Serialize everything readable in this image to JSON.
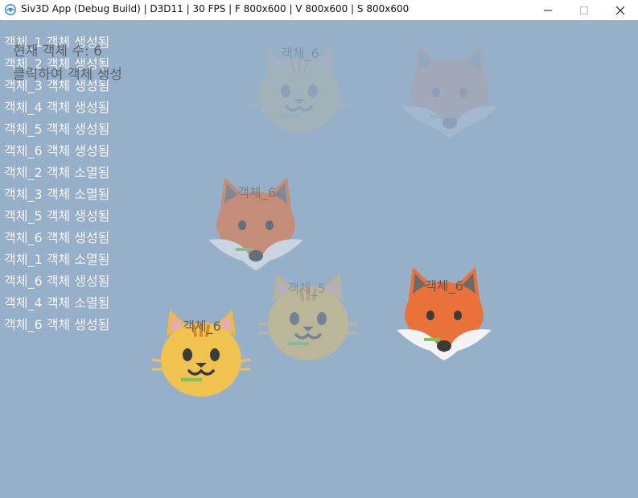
{
  "window": {
    "title": "Siv3D App (Debug Build) | D3D11 | 30 FPS | F 800x600 | V 800x600 | S 800x600",
    "controls": {
      "minimize_icon": "minimize-icon",
      "maximize_icon": "maximize-icon",
      "close_icon": "close-icon"
    }
  },
  "canvas": {
    "background": "#97b0ca",
    "object_count_text": "현재 객체 수: 6",
    "hint_text": "클릭하여 객체 생성"
  },
  "log": [
    "객체_1 객체 생성됨",
    "객체_2 객체 생성됨",
    "객체_3 객체 생성됨",
    "객체_4 객체 생성됨",
    "객체_5 객체 생성됨",
    "객체_6 객체 생성됨",
    "객체_2 객체 소멸됨",
    "객체_3 객체 소멸됨",
    "객체_5 객체 생성됨",
    "객체_6 객체 생성됨",
    "객체_1 객체 소멸됨",
    "객체_6 객체 생성됨",
    "객체_4 객체 소멸됨",
    "객체_6 객체 생성됨"
  ],
  "entities": [
    {
      "label": "객체_6",
      "kind": "cat",
      "opacity": 0.12
    },
    {
      "label": "",
      "kind": "fox",
      "opacity": 0.12
    },
    {
      "label": "객체_6",
      "kind": "fox",
      "opacity": 0.55
    },
    {
      "label": "객체_5",
      "kind": "cat",
      "opacity": 0.38
    },
    {
      "label": "객체_6",
      "kind": "fox",
      "opacity": 1.0
    },
    {
      "label": "객체_6",
      "kind": "cat",
      "opacity": 1.0
    }
  ]
}
